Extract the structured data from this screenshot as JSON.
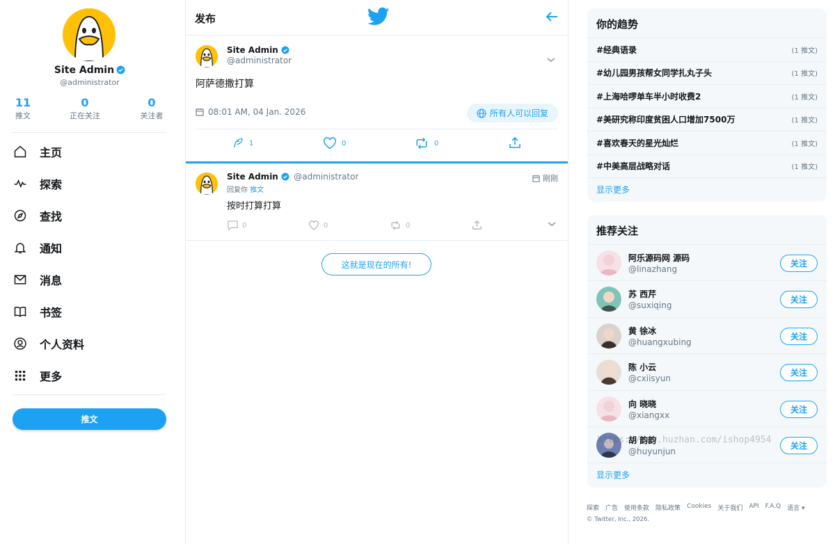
{
  "profile": {
    "name": "Site Admin",
    "handle": "@administrator",
    "stats": [
      {
        "num": "11",
        "label": "推文"
      },
      {
        "num": "0",
        "label": "正在关注"
      },
      {
        "num": "0",
        "label": "关注者"
      }
    ]
  },
  "nav": [
    {
      "label": "主页",
      "icon": "home-icon"
    },
    {
      "label": "探索",
      "icon": "pulse-icon"
    },
    {
      "label": "查找",
      "icon": "compass-icon"
    },
    {
      "label": "通知",
      "icon": "bell-icon"
    },
    {
      "label": "消息",
      "icon": "mail-icon"
    },
    {
      "label": "书签",
      "icon": "book-icon"
    },
    {
      "label": "个人资料",
      "icon": "user-icon"
    },
    {
      "label": "更多",
      "icon": "grid-icon"
    }
  ],
  "tweet_button": "推文",
  "center": {
    "title": "发布",
    "post": {
      "name": "Site Admin",
      "handle": "@administrator",
      "text": "阿萨德撒打算",
      "time": "08:01 AM, 04 Jan. 2026",
      "reply_scope": "所有人可以回复",
      "actions": {
        "replies": "1",
        "likes": "0",
        "reposts": "0"
      }
    },
    "reply": {
      "name": "Site Admin",
      "handle": "@administrator",
      "reply_to_prefix": "回复你",
      "reply_to_link": "推文",
      "time": "刚刚",
      "text": "按时打算打算",
      "actions": {
        "replies": "0",
        "likes": "0",
        "reposts": "0"
      }
    },
    "end_label": "这就是现在的所有!"
  },
  "trends": {
    "title": "你的趋势",
    "items": [
      {
        "tag": "#经典语录",
        "count": "(1 推文)"
      },
      {
        "tag": "#幼儿园男孩帮女同学扎丸子头",
        "count": "(1 推文)"
      },
      {
        "tag": "#上海哈啰单车半小时收费2",
        "count": "(1 推文)"
      },
      {
        "tag": "#美研究称印度贫困人口增加7500万",
        "count": "(1 推文)"
      },
      {
        "tag": "#喜欢春天的星光灿烂",
        "count": "(1 推文)"
      },
      {
        "tag": "#中美高层战略对话",
        "count": "(1 推文)"
      }
    ],
    "show_more": "显示更多"
  },
  "recommend": {
    "title": "推荐关注",
    "follow_label": "关注",
    "users": [
      {
        "name": "阿乐源码网 源码",
        "handle": "@linazhang",
        "color": "#f3d1d8"
      },
      {
        "name": "苏 西芹",
        "handle": "@suxiqing",
        "color": "#7fc4b8"
      },
      {
        "name": "黄 徐冰",
        "handle": "@huangxubing",
        "color": "#6b5a58"
      },
      {
        "name": "陈 小云",
        "handle": "@cxiisyun",
        "color": "#caa896"
      },
      {
        "name": "向 晓晓",
        "handle": "@xiangxx",
        "color": "#f0c7cf"
      },
      {
        "name": "胡 韵韵",
        "handle": "@huyunjun",
        "color": "#6d7fb0"
      }
    ],
    "show_more": "显示更多"
  },
  "footer": {
    "links": [
      "探索",
      "广告",
      "使用条款",
      "隐私政策",
      "Cookies",
      "关于我们",
      "API",
      "F.A.Q",
      "语言 ▾"
    ],
    "copyright": "© Twitter, Inc., 2026."
  },
  "watermark": "https://www.huzhan.com/ishop4954",
  "colors": {
    "accent": "#1da1f2",
    "avatar": "#ffc107"
  }
}
